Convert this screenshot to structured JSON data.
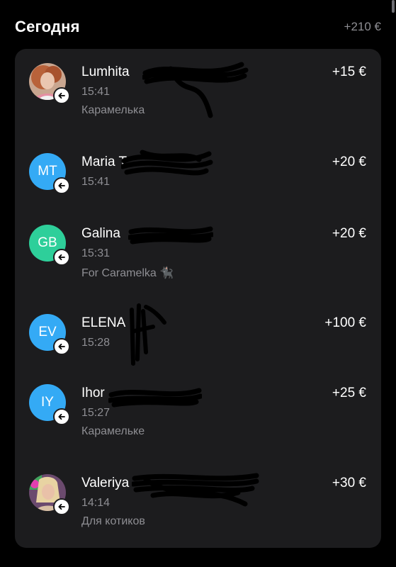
{
  "header": {
    "title": "Сегодня",
    "total": "+210 €"
  },
  "colors": {
    "background": "#000000",
    "card": "#1c1c1e",
    "secondary_text": "#8e8e93",
    "avatar_blue": "#34aaf5",
    "avatar_green": "#2ecf9a"
  },
  "transactions": [
    {
      "name": "Lumhita",
      "time": "15:41",
      "comment": "Карамелька",
      "amount": "+15 €",
      "avatar_type": "photo",
      "direction_icon": "arrow-left-icon"
    },
    {
      "name": "Maria T",
      "time": "15:41",
      "comment": "",
      "amount": "+20 €",
      "avatar_type": "initials",
      "initials": "MT",
      "avatar_color": "#34aaf5",
      "direction_icon": "arrow-left-icon"
    },
    {
      "name": "Galina",
      "time": "15:31",
      "comment": "For Caramelka 🐈‍⬛",
      "amount": "+20 €",
      "avatar_type": "initials",
      "initials": "GB",
      "avatar_color": "#2ecf9a",
      "direction_icon": "arrow-left-icon"
    },
    {
      "name": "ELENA",
      "time": "15:28",
      "comment": "",
      "amount": "+100 €",
      "avatar_type": "initials",
      "initials": "EV",
      "avatar_color": "#34aaf5",
      "direction_icon": "arrow-left-icon"
    },
    {
      "name": "Ihor",
      "time": "15:27",
      "comment": "Карамельке",
      "amount": "+25 €",
      "avatar_type": "initials",
      "initials": "IY",
      "avatar_color": "#34aaf5",
      "direction_icon": "arrow-left-icon"
    },
    {
      "name": "Valeriya",
      "time": "14:14",
      "comment": "Для котиков",
      "amount": "+30 €",
      "avatar_type": "photo",
      "direction_icon": "arrow-left-icon"
    }
  ]
}
